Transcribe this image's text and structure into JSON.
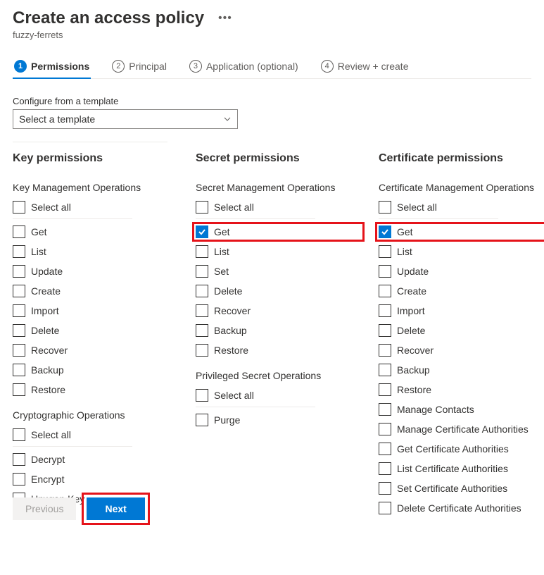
{
  "header": {
    "title": "Create an access policy",
    "subtitle": "fuzzy-ferrets"
  },
  "tabs": [
    {
      "num": "1",
      "label": "Permissions",
      "active": true
    },
    {
      "num": "2",
      "label": "Principal",
      "active": false
    },
    {
      "num": "3",
      "label": "Application (optional)",
      "active": false
    },
    {
      "num": "4",
      "label": "Review + create",
      "active": false
    }
  ],
  "template": {
    "label": "Configure from a template",
    "selected": "Select a template"
  },
  "columns": [
    {
      "header": "Key permissions",
      "groups": [
        {
          "header": "Key Management Operations",
          "items": [
            {
              "label": "Select all",
              "checked": false,
              "sep_after": true
            },
            {
              "label": "Get",
              "checked": false
            },
            {
              "label": "List",
              "checked": false
            },
            {
              "label": "Update",
              "checked": false
            },
            {
              "label": "Create",
              "checked": false
            },
            {
              "label": "Import",
              "checked": false
            },
            {
              "label": "Delete",
              "checked": false
            },
            {
              "label": "Recover",
              "checked": false
            },
            {
              "label": "Backup",
              "checked": false
            },
            {
              "label": "Restore",
              "checked": false
            }
          ]
        },
        {
          "header": "Cryptographic Operations",
          "items": [
            {
              "label": "Select all",
              "checked": false,
              "sep_after": true
            },
            {
              "label": "Decrypt",
              "checked": false
            },
            {
              "label": "Encrypt",
              "checked": false
            },
            {
              "label": "Unwrap Key",
              "checked": false
            }
          ]
        }
      ]
    },
    {
      "header": "Secret permissions",
      "groups": [
        {
          "header": "Secret Management Operations",
          "items": [
            {
              "label": "Select all",
              "checked": false,
              "sep_after": true
            },
            {
              "label": "Get",
              "checked": true,
              "highlight": true
            },
            {
              "label": "List",
              "checked": false
            },
            {
              "label": "Set",
              "checked": false
            },
            {
              "label": "Delete",
              "checked": false
            },
            {
              "label": "Recover",
              "checked": false
            },
            {
              "label": "Backup",
              "checked": false
            },
            {
              "label": "Restore",
              "checked": false
            }
          ]
        },
        {
          "header": "Privileged Secret Operations",
          "items": [
            {
              "label": "Select all",
              "checked": false,
              "sep_after": true
            },
            {
              "label": "Purge",
              "checked": false
            }
          ]
        }
      ]
    },
    {
      "header": "Certificate permissions",
      "groups": [
        {
          "header": "Certificate Management Operations",
          "items": [
            {
              "label": "Select all",
              "checked": false,
              "sep_after": true
            },
            {
              "label": "Get",
              "checked": true,
              "highlight": true
            },
            {
              "label": "List",
              "checked": false
            },
            {
              "label": "Update",
              "checked": false
            },
            {
              "label": "Create",
              "checked": false
            },
            {
              "label": "Import",
              "checked": false
            },
            {
              "label": "Delete",
              "checked": false
            },
            {
              "label": "Recover",
              "checked": false
            },
            {
              "label": "Backup",
              "checked": false
            },
            {
              "label": "Restore",
              "checked": false
            },
            {
              "label": "Manage Contacts",
              "checked": false
            },
            {
              "label": "Manage Certificate Authorities",
              "checked": false
            },
            {
              "label": "Get Certificate Authorities",
              "checked": false
            },
            {
              "label": "List Certificate Authorities",
              "checked": false
            },
            {
              "label": "Set Certificate Authorities",
              "checked": false
            },
            {
              "label": "Delete Certificate Authorities",
              "checked": false
            }
          ]
        }
      ]
    }
  ],
  "footer": {
    "previous": "Previous",
    "next": "Next"
  }
}
